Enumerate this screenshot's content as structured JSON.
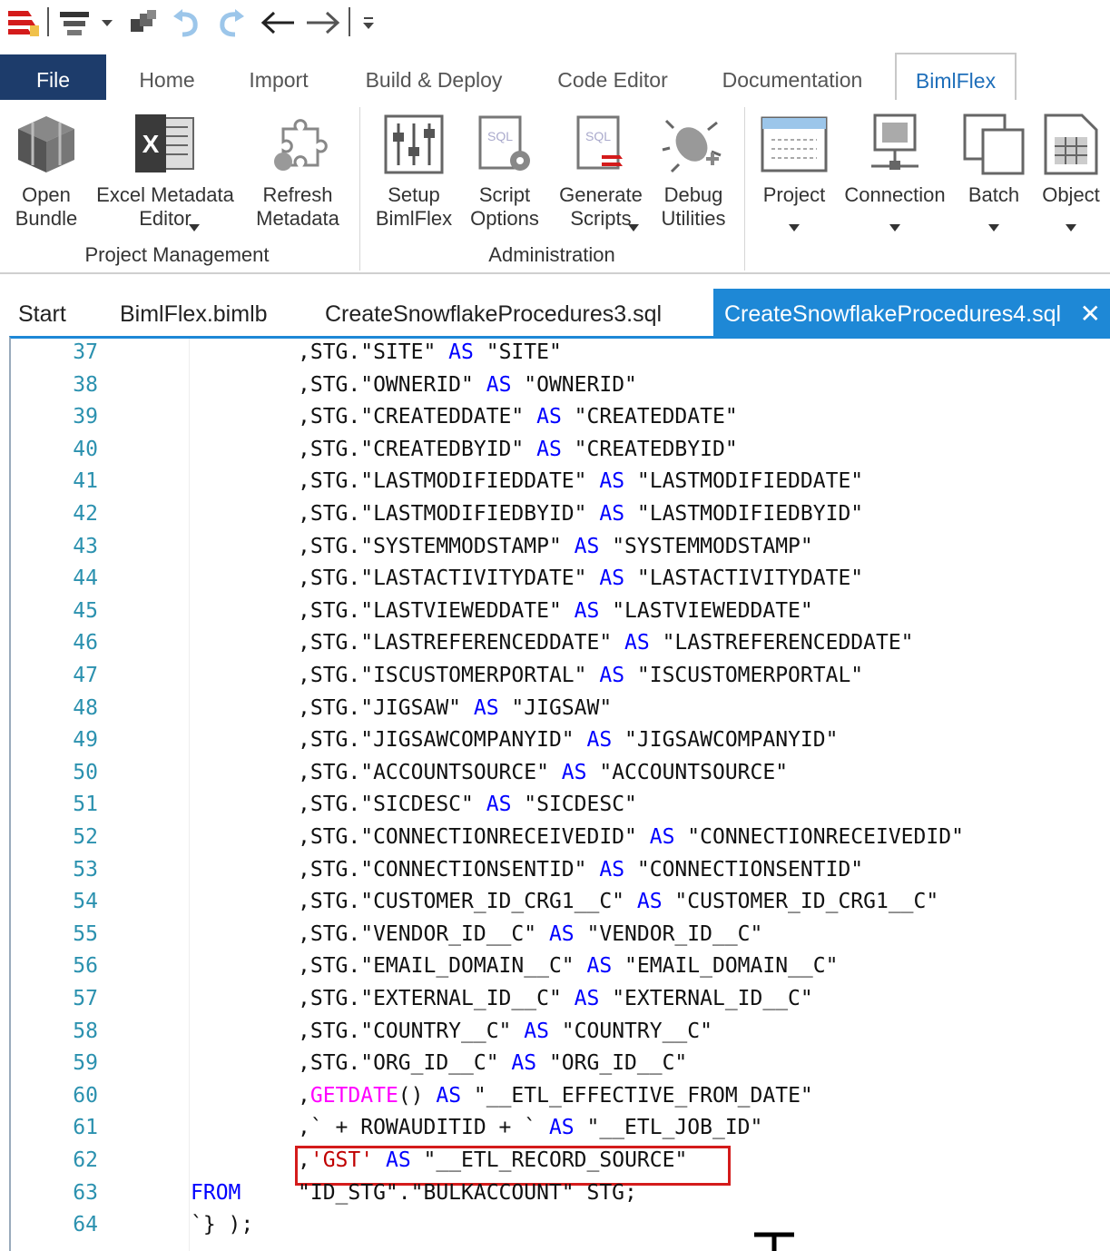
{
  "toolbar": {
    "icons": [
      "app-logo-icon",
      "layout-icon",
      "dropdown-arrow-icon",
      "copy-windows-icon",
      "undo-icon",
      "redo-icon",
      "back-arrow-icon",
      "forward-arrow-icon",
      "customize-dropdown-icon"
    ]
  },
  "ribbon_tabs": [
    {
      "label": "File"
    },
    {
      "label": "Home"
    },
    {
      "label": "Import"
    },
    {
      "label": "Build & Deploy"
    },
    {
      "label": "Code Editor"
    },
    {
      "label": "Documentation"
    },
    {
      "label": "BimlFlex"
    }
  ],
  "ribbon": {
    "buttons": [
      {
        "label": "Open\nBundle",
        "icon": "bundle-icon",
        "dropdown": false
      },
      {
        "label": "Excel Metadata\nEditor",
        "icon": "excel-icon",
        "dropdown": true
      },
      {
        "label": "Refresh\nMetadata",
        "icon": "puzzle-refresh-icon",
        "dropdown": false
      },
      {
        "label": "Setup\nBimlFlex",
        "icon": "sliders-icon",
        "dropdown": false
      },
      {
        "label": "Script\nOptions",
        "icon": "sql-gear-icon",
        "dropdown": false
      },
      {
        "label": "Generate\nScripts",
        "icon": "sql-generate-icon",
        "dropdown": true
      },
      {
        "label": "Debug\nUtilities",
        "icon": "bug-icon",
        "dropdown": false
      },
      {
        "label": "Project",
        "icon": "project-icon",
        "dropdown": true
      },
      {
        "label": "Connection",
        "icon": "connection-icon",
        "dropdown": true
      },
      {
        "label": "Batch",
        "icon": "batch-icon",
        "dropdown": true
      },
      {
        "label": "Object",
        "icon": "object-table-icon",
        "dropdown": true
      }
    ],
    "groups": [
      "Project Management",
      "Administration"
    ]
  },
  "doc_tabs": [
    {
      "label": "Start"
    },
    {
      "label": "BimlFlex.bimlb"
    },
    {
      "label": "CreateSnowflakeProcedures3.sql"
    },
    {
      "label": "CreateSnowflakeProcedures4.sql",
      "close": "✕"
    }
  ],
  "editor": {
    "lines": [
      {
        "n": "37",
        "parts": [
          {
            "c": "t",
            "v": ",STG.\"SITE\" "
          },
          {
            "c": "k",
            "v": "AS"
          },
          {
            "c": "t",
            "v": " \"SITE\""
          }
        ]
      },
      {
        "n": "38",
        "parts": [
          {
            "c": "t",
            "v": ",STG.\"OWNERID\" "
          },
          {
            "c": "k",
            "v": "AS"
          },
          {
            "c": "t",
            "v": " \"OWNERID\""
          }
        ]
      },
      {
        "n": "39",
        "parts": [
          {
            "c": "t",
            "v": ",STG.\"CREATEDDATE\" "
          },
          {
            "c": "k",
            "v": "AS"
          },
          {
            "c": "t",
            "v": " \"CREATEDDATE\""
          }
        ]
      },
      {
        "n": "40",
        "parts": [
          {
            "c": "t",
            "v": ",STG.\"CREATEDBYID\" "
          },
          {
            "c": "k",
            "v": "AS"
          },
          {
            "c": "t",
            "v": " \"CREATEDBYID\""
          }
        ]
      },
      {
        "n": "41",
        "parts": [
          {
            "c": "t",
            "v": ",STG.\"LASTMODIFIEDDATE\" "
          },
          {
            "c": "k",
            "v": "AS"
          },
          {
            "c": "t",
            "v": " \"LASTMODIFIEDDATE\""
          }
        ]
      },
      {
        "n": "42",
        "parts": [
          {
            "c": "t",
            "v": ",STG.\"LASTMODIFIEDBYID\" "
          },
          {
            "c": "k",
            "v": "AS"
          },
          {
            "c": "t",
            "v": " \"LASTMODIFIEDBYID\""
          }
        ]
      },
      {
        "n": "43",
        "parts": [
          {
            "c": "t",
            "v": ",STG.\"SYSTEMMODSTAMP\" "
          },
          {
            "c": "k",
            "v": "AS"
          },
          {
            "c": "t",
            "v": " \"SYSTEMMODSTAMP\""
          }
        ]
      },
      {
        "n": "44",
        "parts": [
          {
            "c": "t",
            "v": ",STG.\"LASTACTIVITYDATE\" "
          },
          {
            "c": "k",
            "v": "AS"
          },
          {
            "c": "t",
            "v": " \"LASTACTIVITYDATE\""
          }
        ]
      },
      {
        "n": "45",
        "parts": [
          {
            "c": "t",
            "v": ",STG.\"LASTVIEWEDDATE\" "
          },
          {
            "c": "k",
            "v": "AS"
          },
          {
            "c": "t",
            "v": " \"LASTVIEWEDDATE\""
          }
        ]
      },
      {
        "n": "46",
        "parts": [
          {
            "c": "t",
            "v": ",STG.\"LASTREFERENCEDDATE\" "
          },
          {
            "c": "k",
            "v": "AS"
          },
          {
            "c": "t",
            "v": " \"LASTREFERENCEDDATE\""
          }
        ]
      },
      {
        "n": "47",
        "parts": [
          {
            "c": "t",
            "v": ",STG.\"ISCUSTOMERPORTAL\" "
          },
          {
            "c": "k",
            "v": "AS"
          },
          {
            "c": "t",
            "v": " \"ISCUSTOMERPORTAL\""
          }
        ]
      },
      {
        "n": "48",
        "parts": [
          {
            "c": "t",
            "v": ",STG.\"JIGSAW\" "
          },
          {
            "c": "k",
            "v": "AS"
          },
          {
            "c": "t",
            "v": " \"JIGSAW\""
          }
        ]
      },
      {
        "n": "49",
        "parts": [
          {
            "c": "t",
            "v": ",STG.\"JIGSAWCOMPANYID\" "
          },
          {
            "c": "k",
            "v": "AS"
          },
          {
            "c": "t",
            "v": " \"JIGSAWCOMPANYID\""
          }
        ]
      },
      {
        "n": "50",
        "parts": [
          {
            "c": "t",
            "v": ",STG.\"ACCOUNTSOURCE\" "
          },
          {
            "c": "k",
            "v": "AS"
          },
          {
            "c": "t",
            "v": " \"ACCOUNTSOURCE\""
          }
        ]
      },
      {
        "n": "51",
        "parts": [
          {
            "c": "t",
            "v": ",STG.\"SICDESC\" "
          },
          {
            "c": "k",
            "v": "AS"
          },
          {
            "c": "t",
            "v": " \"SICDESC\""
          }
        ]
      },
      {
        "n": "52",
        "parts": [
          {
            "c": "t",
            "v": ",STG.\"CONNECTIONRECEIVEDID\" "
          },
          {
            "c": "k",
            "v": "AS"
          },
          {
            "c": "t",
            "v": " \"CONNECTIONRECEIVEDID\""
          }
        ]
      },
      {
        "n": "53",
        "parts": [
          {
            "c": "t",
            "v": ",STG.\"CONNECTIONSENTID\" "
          },
          {
            "c": "k",
            "v": "AS"
          },
          {
            "c": "t",
            "v": " \"CONNECTIONSENTID\""
          }
        ]
      },
      {
        "n": "54",
        "parts": [
          {
            "c": "t",
            "v": ",STG.\"CUSTOMER_ID_CRG1__C\" "
          },
          {
            "c": "k",
            "v": "AS"
          },
          {
            "c": "t",
            "v": " \"CUSTOMER_ID_CRG1__C\""
          }
        ]
      },
      {
        "n": "55",
        "parts": [
          {
            "c": "t",
            "v": ",STG.\"VENDOR_ID__C\" "
          },
          {
            "c": "k",
            "v": "AS"
          },
          {
            "c": "t",
            "v": " \"VENDOR_ID__C\""
          }
        ]
      },
      {
        "n": "56",
        "parts": [
          {
            "c": "t",
            "v": ",STG.\"EMAIL_DOMAIN__C\" "
          },
          {
            "c": "k",
            "v": "AS"
          },
          {
            "c": "t",
            "v": " \"EMAIL_DOMAIN__C\""
          }
        ]
      },
      {
        "n": "57",
        "parts": [
          {
            "c": "t",
            "v": ",STG.\"EXTERNAL_ID__C\" "
          },
          {
            "c": "k",
            "v": "AS"
          },
          {
            "c": "t",
            "v": " \"EXTERNAL_ID__C\""
          }
        ]
      },
      {
        "n": "58",
        "parts": [
          {
            "c": "t",
            "v": ",STG.\"COUNTRY__C\" "
          },
          {
            "c": "k",
            "v": "AS"
          },
          {
            "c": "t",
            "v": " \"COUNTRY__C\""
          }
        ]
      },
      {
        "n": "59",
        "parts": [
          {
            "c": "t",
            "v": ",STG.\"ORG_ID__C\" "
          },
          {
            "c": "k",
            "v": "AS"
          },
          {
            "c": "t",
            "v": " \"ORG_ID__C\""
          }
        ]
      },
      {
        "n": "60",
        "parts": [
          {
            "c": "t",
            "v": ","
          },
          {
            "c": "f",
            "v": "GETDATE"
          },
          {
            "c": "t",
            "v": "() "
          },
          {
            "c": "k",
            "v": "AS"
          },
          {
            "c": "t",
            "v": " \"__ETL_EFFECTIVE_FROM_DATE\""
          }
        ]
      },
      {
        "n": "61",
        "parts": [
          {
            "c": "t",
            "v": ",` + ROWAUDITID + ` "
          },
          {
            "c": "k",
            "v": "AS"
          },
          {
            "c": "t",
            "v": " \"__ETL_JOB_ID\""
          }
        ]
      },
      {
        "n": "62",
        "parts": [
          {
            "c": "t",
            "v": ","
          },
          {
            "c": "r",
            "v": "'GST'"
          },
          {
            "c": "t",
            "v": " "
          },
          {
            "c": "k",
            "v": "AS"
          },
          {
            "c": "t",
            "v": " \"__ETL_RECORD_SOURCE\""
          }
        ]
      },
      {
        "n": "63",
        "from": "FROM",
        "parts": [
          {
            "c": "t",
            "v": "\"ID_STG\".\"BULKACCOUNT\" STG;"
          }
        ]
      },
      {
        "n": "64",
        "indent_small": true,
        "parts": [
          {
            "c": "t",
            "v": "`} );"
          }
        ]
      }
    ]
  },
  "colors": {
    "file_tab": "#1d3c6b",
    "active_tab_text": "#1f6fba",
    "doc_tab_active": "#1e88d6",
    "keyword": "#0000ff",
    "function": "#ff00ff",
    "string_literal": "#c00000",
    "line_number": "#2b91af",
    "highlight_box": "#d41b1b"
  }
}
